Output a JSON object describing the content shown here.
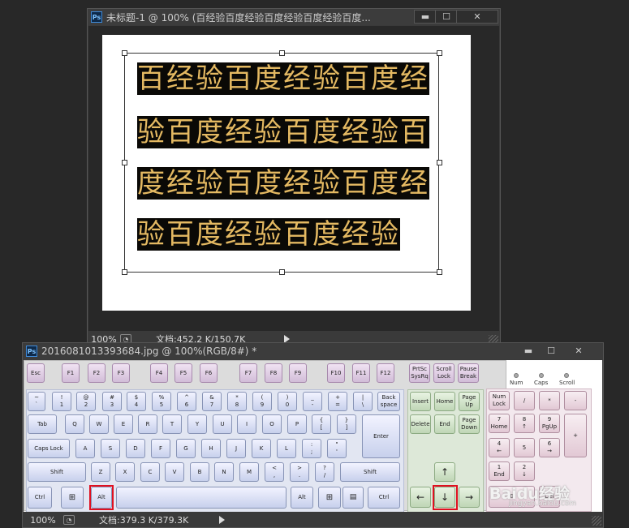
{
  "colors": {
    "app_bg": "#282828",
    "text_fill": "#0a0906",
    "text_color": "#e4b962",
    "highlight": "#e01020"
  },
  "doc_window": {
    "title": "未标题-1 @ 100% (百经验百度经验百度经验百度经验百度...",
    "zoom": "100%",
    "doc_info": "文档:452.2 K/150.7K",
    "text_lines": [
      "百经验百度经验百度经",
      "验百度经验百度经验百",
      "度经验百度经验百度经",
      "验百度经验百度经验"
    ]
  },
  "kb_window": {
    "title": "2016081013393684.jpg @ 100%(RGB/8#) *",
    "zoom": "100%",
    "doc_info": "文档:379.3 K/379.3K"
  },
  "window_controls": {
    "minimize": "▬",
    "maximize": "☐",
    "close": "✕"
  },
  "keyboard": {
    "leds": [
      "Num",
      "Caps",
      "Scroll"
    ],
    "keys": {
      "esc": "Esc",
      "f1": "F1",
      "f2": "F2",
      "f3": "F3",
      "f4": "F4",
      "f5": "F5",
      "f6": "F6",
      "f7": "F7",
      "f8": "F8",
      "f9": "F9",
      "f10": "F10",
      "f11": "F11",
      "f12": "F12",
      "prtsc": "PrtSc\nSysRq",
      "scroll": "Scroll\nLock",
      "pause": "Pause\nBreak",
      "tilde": "~\n`",
      "d1": "!\n1",
      "d2": "@\n2",
      "d3": "#\n3",
      "d4": "$\n4",
      "d5": "%\n5",
      "d6": "^\n6",
      "d7": "&\n7",
      "d8": "*\n8",
      "d9": "(\n9",
      "d0": ")\n0",
      "minus": "_\n-",
      "plus": "+\n=",
      "bslash": "|\n\\",
      "back": "Back\nspace",
      "tab": "Tab",
      "q": "Q",
      "w": "W",
      "e": "E",
      "r": "R",
      "t": "T",
      "y": "Y",
      "u": "U",
      "i": "I",
      "o": "O",
      "p": "P",
      "lbr": "{\n[",
      "rbr": "}\n]",
      "caps": "Caps Lock",
      "a": "A",
      "s": "S",
      "d": "D",
      "f": "F",
      "g": "G",
      "h": "H",
      "j": "J",
      "k": "K",
      "l": "L",
      "semi": ":\n;",
      "quote": "\"\n'",
      "enter": "Enter",
      "lshift": "Shift",
      "z": "Z",
      "x": "X",
      "c": "C",
      "v": "V",
      "b": "B",
      "n": "N",
      "m": "M",
      "comma": "<\n,",
      "period": ">\n.",
      "slash": "?\n/",
      "rshift": "Shift",
      "lctrl": "Ctrl",
      "lalt": "Alt",
      "ralt": "Alt",
      "rctrl": "Ctrl",
      "insert": "Insert",
      "home": "Home",
      "pgup": "Page\nUp",
      "delete": "Delete",
      "end": "End",
      "pgdn": "Page\nDown",
      "up": "↑",
      "left": "←",
      "down": "↓",
      "right": "→",
      "numlock": "Num\nLock",
      "ndiv": "/",
      "nmul": "*",
      "nsub": "-",
      "n7": "7\nHome",
      "n8": "8\n↑",
      "n9": "9\nPgUp",
      "nadd": "+",
      "n4": "4\n←",
      "n5": "5",
      "n6": "6\n→",
      "n1": "1\nEnd",
      "n2": "2\n↓",
      "n0": "0",
      "ndel": "Del"
    }
  },
  "watermark": {
    "brand": "Baidu经验",
    "url": "jingyan.baidu.com"
  }
}
